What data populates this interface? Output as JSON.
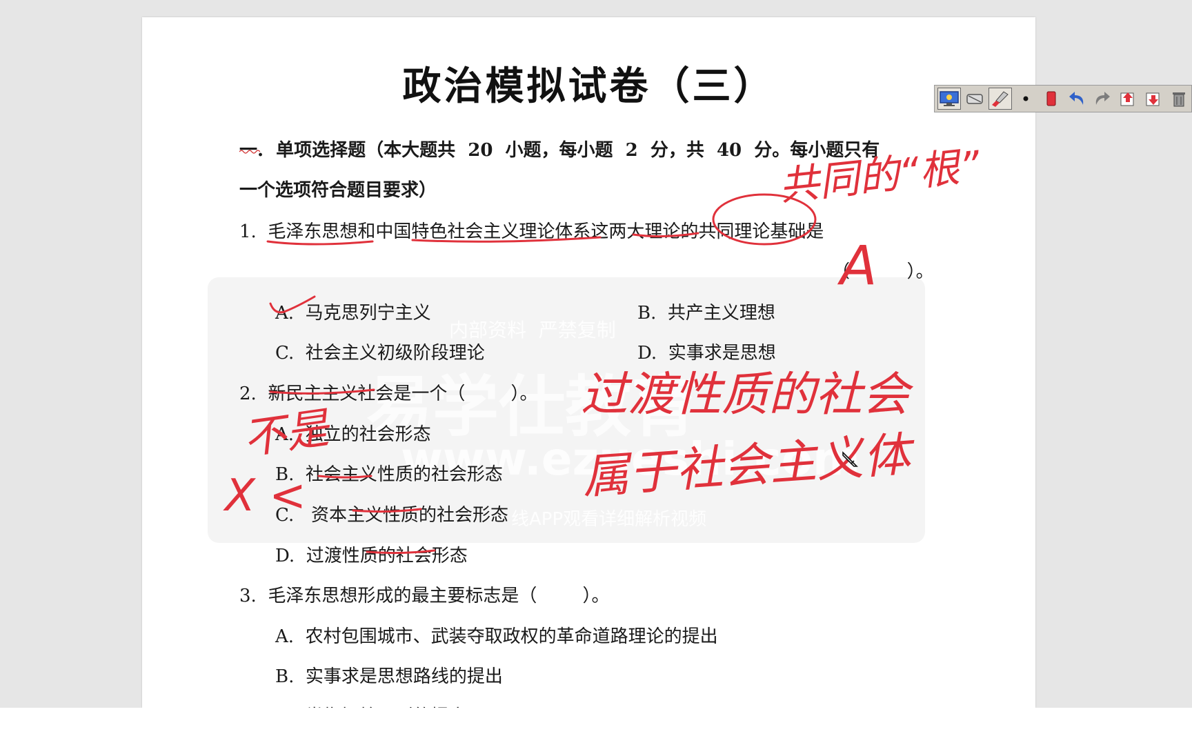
{
  "document": {
    "title": "政治模拟试卷（三）",
    "section_heading_line1": "一.  单项选择题（本大题共  20  小题，每小题  2  分，共  40  分。每小题只有",
    "section_heading_line2": "一个选项符合题目要求）",
    "questions": [
      {
        "stem": "1.  毛泽东思想和中国特色社会主义理论体系这两大理论的共同理论基础是",
        "answer_blank": "（          ）。",
        "options": [
          "A.  马克思列宁主义",
          "B.  共产主义理想",
          "C.  社会主义初级阶段理论",
          "D.  实事求是思想"
        ]
      },
      {
        "stem": "2.  新民主主义社会是一个（        ）。",
        "options": [
          "A.  独立的社会形态",
          "B.  社会主义性质的社会形态",
          "C.   资本主义性质的社会形态",
          "D.  过渡性质的社会形态"
        ]
      },
      {
        "stem": "3.  毛泽东思想形成的最主要标志是（        ）。",
        "options": [
          "A.  农村包围城市、武装夺取政权的革命道路理论的提出",
          "B.  实事求是思想路线的提出",
          "C.  党指挥枪原则的提出"
        ]
      }
    ]
  },
  "watermark": {
    "line1": "内部资料  严禁复制",
    "line2": "易学仕教育",
    "line3": "www.ezueshi.com",
    "line4": "线APP观看详细解析视频"
  },
  "annotations": {
    "note_gen": "共同的“根”",
    "answer_q1": "A",
    "not_label": "不是",
    "wrong_marks": "X <",
    "note_transition": "过渡性质的社会",
    "note_belongs": "属于社会主义体"
  },
  "toolbar": {
    "tools": [
      "monitor-icon",
      "eraser-icon",
      "brush-icon",
      "dot-size-icon",
      "pen-color-icon",
      "undo-icon",
      "redo-icon",
      "page-up-icon",
      "page-down-icon",
      "trash-icon"
    ]
  },
  "colors": {
    "ink": "#e0313b",
    "page": "#ffffff",
    "workspace": "#e6e6e6",
    "toolbar": "#d4d0c8"
  }
}
